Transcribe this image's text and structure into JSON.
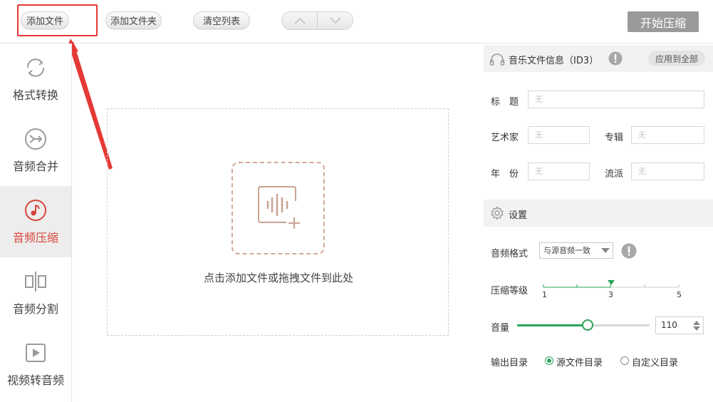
{
  "toolbar": {
    "add_file": "添加文件",
    "add_folder": "添加文件夹",
    "clear_list": "清空列表",
    "start": "开始压缩"
  },
  "sidebar": {
    "items": [
      {
        "label": "格式转换",
        "icon": "convert-icon"
      },
      {
        "label": "音频合并",
        "icon": "merge-icon"
      },
      {
        "label": "音频压缩",
        "icon": "compress-icon"
      },
      {
        "label": "音频分割",
        "icon": "split-icon"
      },
      {
        "label": "视频转音频",
        "icon": "video-icon"
      }
    ],
    "active_index": 2
  },
  "dropzone": {
    "text": "点击添加文件或拖拽文件到此处"
  },
  "id3": {
    "title": "音乐文件信息（ID3）",
    "apply_all": "应用到全部",
    "fields": {
      "title_label": "标　题",
      "artist_label": "艺术家",
      "album_label": "专辑",
      "year_label": "年　份",
      "genre_label": "流派",
      "placeholder": "无"
    }
  },
  "settings": {
    "title": "设置",
    "format_label": "音频格式",
    "format_value": "与源音频一致",
    "level_label": "压缩等级",
    "level_ticks": [
      "1",
      "3",
      "5"
    ],
    "level_value": 3,
    "level_min": 1,
    "level_max": 5,
    "volume_label": "音量",
    "volume_value": "110",
    "volume_fraction": 0.53,
    "output_label": "输出目录",
    "output_source": "源文件目录",
    "output_custom": "自定义目录",
    "output_selected": "source"
  },
  "colors": {
    "accent_green": "#2aa35a",
    "accent_red": "#d9453a",
    "highlight_red": "#e53935"
  }
}
